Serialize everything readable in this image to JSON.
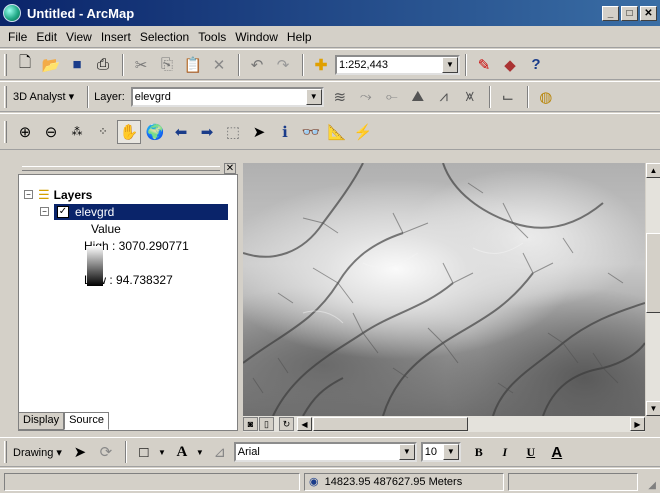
{
  "window": {
    "title": "Untitled - ArcMap"
  },
  "menu": [
    "File",
    "Edit",
    "View",
    "Insert",
    "Selection",
    "Tools",
    "Window",
    "Help"
  ],
  "standard_toolbar": {
    "scale_value": "1:252,443",
    "icons": [
      "new-icon",
      "open-icon",
      "save-icon",
      "print-icon",
      "cut-icon",
      "copy-icon",
      "paste-icon",
      "delete-icon",
      "undo-icon",
      "redo-icon",
      "add-data-icon",
      "editor-icon",
      "arctoolbox-icon",
      "whats-this-icon"
    ]
  },
  "analyst_toolbar": {
    "menu_label": "3D Analyst",
    "layer_label": "Layer:",
    "layer_value": "elevgrd"
  },
  "tools_toolbar": {
    "icons": [
      "zoom-in-icon",
      "zoom-out-icon",
      "fixed-zoom-in-icon",
      "fixed-zoom-out-icon",
      "pan-icon",
      "full-extent-icon",
      "back-icon",
      "forward-icon",
      "select-features-icon",
      "select-elements-icon",
      "identify-icon",
      "find-icon",
      "measure-icon",
      "hyperlink-icon"
    ]
  },
  "toc": {
    "root_label": "Layers",
    "layer_name": "elevgrd",
    "layer_checked": true,
    "legend_heading": "Value",
    "high_label": "High : 3070.290771",
    "low_label": "Low : 94.738327",
    "tabs": [
      "Display",
      "Source"
    ],
    "active_tab": "Display"
  },
  "drawing_toolbar": {
    "menu_label": "Drawing",
    "font_name": "Arial",
    "font_size": "10",
    "bold": "B",
    "italic": "I",
    "underline": "U",
    "font_color": "A"
  },
  "statusbar": {
    "coordinates": "14823.95  487627.95 Meters"
  },
  "colors": {
    "title_bar": "#0a246a",
    "selection": "#0a246a",
    "chrome": "#d4d0c8"
  }
}
